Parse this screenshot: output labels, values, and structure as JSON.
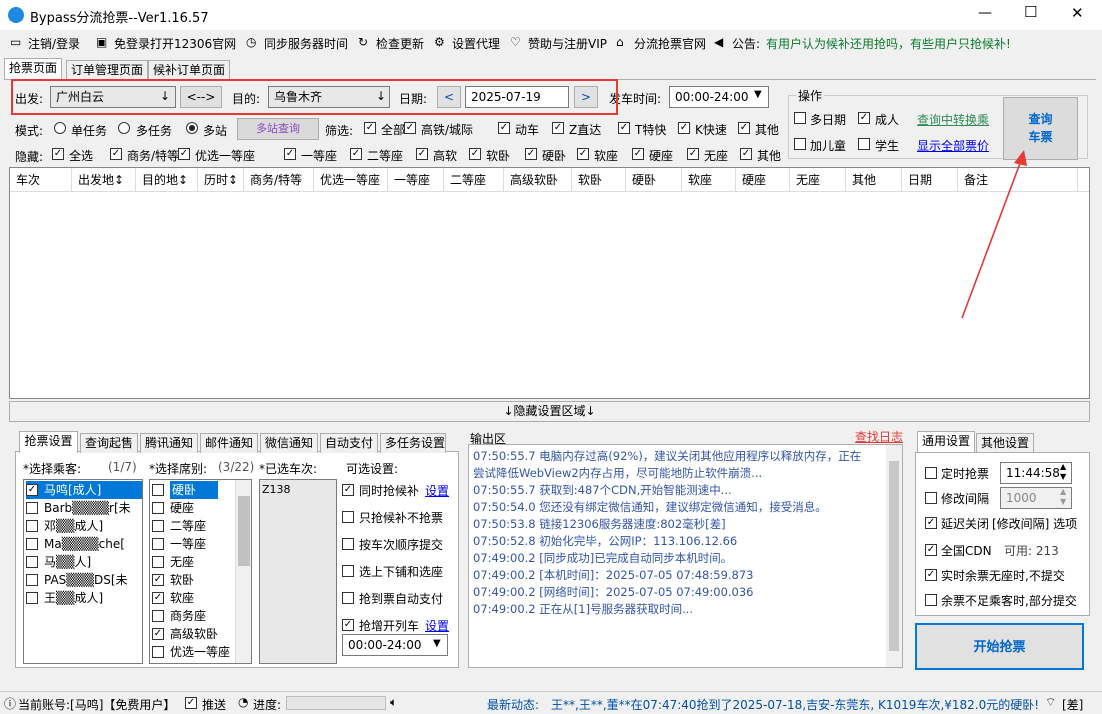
{
  "window": {
    "title": "Bypass分流抢票--Ver1.16.57",
    "min": "—",
    "max": "☐",
    "close": "✕"
  },
  "menu": {
    "items": [
      "注销/登录",
      "免登录打开12306官网",
      "同步服务器时间",
      "检查更新",
      "设置代理",
      "赞助与注册VIP",
      "分流抢票官网",
      "公告:"
    ],
    "notice": "有用户认为候补还用抢吗，有些用户只抢候补!"
  },
  "tabs": [
    "抢票页面",
    "订单管理页面",
    "候补订单页面"
  ],
  "query": {
    "from_label": "出发:",
    "from": "广州白云",
    "swap": "<-->",
    "to_label": "目的:",
    "to": "乌鲁木齐",
    "date_label": "日期:",
    "date": "2025-07-19",
    "prev": "<",
    "next": ">",
    "time_label": "发车时间:",
    "time": "00:00-24:00"
  },
  "ops": {
    "title": "操作",
    "multi_date": "多日期",
    "adult": "成人",
    "transfer": "查询中转换乘",
    "child": "加儿童",
    "student": "学生",
    "show_price": "显示全部票价",
    "search_button": [
      "查询",
      "车票"
    ]
  },
  "mode": {
    "label": "模式:",
    "single": "单任务",
    "multi": "多任务",
    "station": "多站",
    "station_query": "多站查询"
  },
  "filter": {
    "label": "筛选:",
    "items": [
      "全部",
      "高铁/城际",
      "动车",
      "Z直达",
      "T特快",
      "K快速",
      "其他"
    ]
  },
  "hide": {
    "label": "隐藏:",
    "items": [
      "全选",
      "商务/特等",
      "优选一等座",
      "一等座",
      "二等座",
      "高软",
      "软卧",
      "硬卧",
      "软座",
      "硬座",
      "无座",
      "其他"
    ]
  },
  "table": {
    "headers": [
      "车次",
      "出发地↕",
      "目的地↕",
      "历时↕",
      "商务/特等",
      "优选一等座",
      "一等座",
      "二等座",
      "高级软卧",
      "软卧",
      "硬卧",
      "软座",
      "硬座",
      "无座",
      "其他",
      "日期",
      "备注"
    ]
  },
  "hidden_bar": "↓隐藏设置区域↓",
  "lower_tabs": [
    "抢票设置",
    "查询起售",
    "腾讯通知",
    "邮件通知",
    "微信通知",
    "自动支付",
    "多任务设置"
  ],
  "passengers": {
    "label": "*选择乘客:",
    "count": "(1/7)",
    "items": [
      "马鸣[成人]",
      "Barb▒▒▒▒r[未",
      "邓▒▒成人]",
      "Ma▒▒▒▒che[",
      "马▒▒人]",
      "PAS▒▒▒DS[未",
      "王▒▒成人]"
    ],
    "checked": [
      true,
      false,
      false,
      false,
      false,
      false,
      false
    ]
  },
  "seats": {
    "label": "*选择席别:",
    "count": "(3/22)",
    "items": [
      "硬卧",
      "硬座",
      "二等座",
      "一等座",
      "无座",
      "软卧",
      "软座",
      "商务座",
      "高级软卧",
      "优选一等座"
    ],
    "checked": [
      false,
      false,
      false,
      false,
      false,
      true,
      true,
      false,
      true,
      false
    ]
  },
  "selected_trains": {
    "label": "*已选车次:",
    "items": [
      "Z138"
    ]
  },
  "optional": {
    "label": "可选设置:",
    "items": [
      "同时抢候补",
      "只抢候补不抢票",
      "按车次顺序提交",
      "选上下铺和选座",
      "抢到票自动支付",
      "抢增开列车"
    ],
    "checked": [
      true,
      false,
      false,
      false,
      false,
      true
    ],
    "setting": "设置",
    "time": "00:00-24:00"
  },
  "log": {
    "title": "输出区",
    "link": "查找日志",
    "lines": [
      "07:50:55.7  电脑内存过高(92%)，建议关闭其他应用程序以释放内存，正在",
      "尝试降低WebView2内存占用，尽可能地防止软件崩溃...",
      "07:50:55.7  获取到:487个CDN,开始智能测速中...",
      "07:50:54.0  您还没有绑定微信通知，建议绑定微信通知，接受消息。",
      "07:50:53.8  链接12306服务器速度:802毫秒[差]",
      "07:50:52.8  初始化完毕，公网IP：113.106.12.66",
      "07:49:00.2  [同步成功]已完成自动同步本机时间。",
      "07:49:00.2  [本机时间]：2025-07-05 07:48:59.873",
      "07:49:00.2  [网络时间]：2025-07-05 07:49:00.036",
      "07:49:00.2  正在从[1]号服务器获取时间..."
    ]
  },
  "right_tabs": [
    "通用设置",
    "其他设置"
  ],
  "general": {
    "timed": "定时抢票",
    "timed_value": "11:44:58",
    "interval": "修改间隔",
    "interval_value": "1000",
    "delay_close": "延迟关闭",
    "delay_suffix": "[修改间隔] 选项",
    "cdn": "全国CDN",
    "cdn_avail": "可用: 213",
    "realtime": "实时余票无座时,不提交",
    "partial": "余票不足乘客时,部分提交",
    "start": "开始抢票"
  },
  "status": {
    "account": "当前账号:[马鸣]【免费用户】",
    "push": "推送",
    "progress": "进度:",
    "news_label": "最新动态:",
    "news": "王**,王**,董**在07:47:40抢到了2025-07-18,吉安-东莞东, K1019车次,¥182.0元的硬卧!",
    "quality": "[差]"
  },
  "colors": {
    "accent": "#0066cc",
    "red": "#e53935",
    "log_text": "#3355aa",
    "title_bar": "#ffffff"
  }
}
